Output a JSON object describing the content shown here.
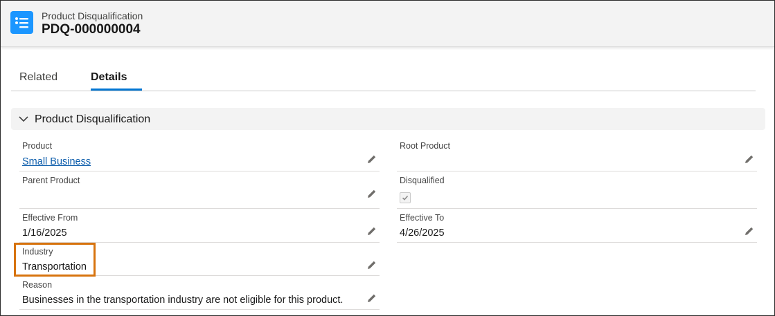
{
  "header": {
    "object_type": "Product Disqualification",
    "record_name": "PDQ-000000004"
  },
  "tabs": [
    {
      "label": "Related",
      "active": false
    },
    {
      "label": "Details",
      "active": true
    }
  ],
  "section": {
    "title": "Product Disqualification"
  },
  "fields": {
    "product": {
      "label": "Product",
      "value": "Small Business"
    },
    "root_product": {
      "label": "Root Product",
      "value": ""
    },
    "parent_product": {
      "label": "Parent Product",
      "value": ""
    },
    "disqualified": {
      "label": "Disqualified",
      "checked": true
    },
    "effective_from": {
      "label": "Effective From",
      "value": "1/16/2025"
    },
    "effective_to": {
      "label": "Effective To",
      "value": "4/26/2025"
    },
    "industry": {
      "label": "Industry",
      "value": "Transportation"
    },
    "reason": {
      "label": "Reason",
      "value": "Businesses in the transportation industry are not eligible for this product."
    }
  },
  "colors": {
    "brand_blue": "#0176d3",
    "icon_blue": "#1b96ff",
    "link": "#0b5cab",
    "highlight": "#d7730e"
  },
  "icons": {
    "object_icon": "list-icon",
    "edit_icon": "pencil-icon",
    "section_toggle": "chevron-down-icon"
  }
}
